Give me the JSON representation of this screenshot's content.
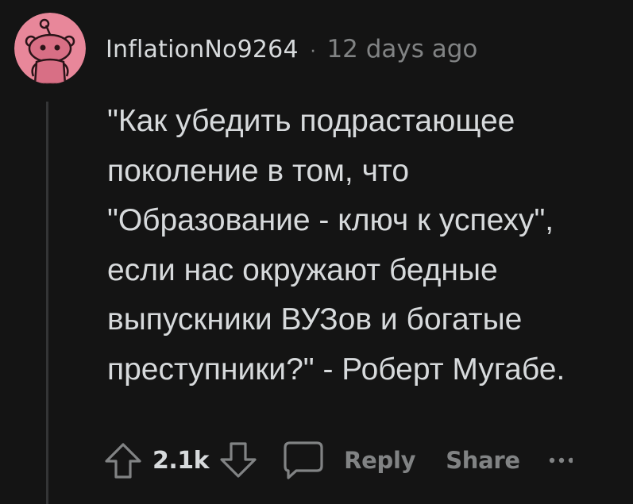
{
  "comment": {
    "author": "InflationNo9264",
    "separator": "·",
    "timestamp": "12 days ago",
    "body": "\"Как убедить подрастающее\nпоколение в том, что\n\"Образование - ключ к успеху\",\nесли нас окружают бедные\nвыпускники ВУЗов и богатые\nпреступники?\" - Роберт Мугабе."
  },
  "actions": {
    "score": "2.1k",
    "reply_label": "Reply",
    "share_label": "Share"
  },
  "icons": {
    "avatar": "reddit-snoo-avatar-icon",
    "upvote": "arrow-up-icon",
    "downvote": "arrow-down-icon",
    "reply": "speech-bubble-icon",
    "more": "more-dots-icon"
  },
  "colors": {
    "background": "#141414",
    "text": "#d7dadc",
    "muted": "#818384",
    "avatar_bg": "#e8879a",
    "thread_line": "#343536"
  }
}
